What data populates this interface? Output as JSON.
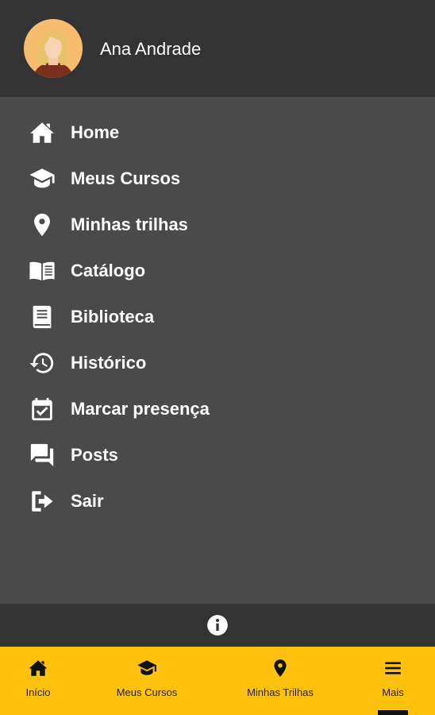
{
  "header": {
    "user_name": "Ana Andrade",
    "avatar_icon": "user-avatar"
  },
  "menu": {
    "items": [
      {
        "label": "Home",
        "icon": "home-icon"
      },
      {
        "label": "Meus Cursos",
        "icon": "graduation-cap-icon"
      },
      {
        "label": "Minhas trilhas",
        "icon": "map-pin-icon"
      },
      {
        "label": "Catálogo",
        "icon": "open-book-icon"
      },
      {
        "label": "Biblioteca",
        "icon": "book-icon"
      },
      {
        "label": "Histórico",
        "icon": "history-icon"
      },
      {
        "label": "Marcar presença",
        "icon": "calendar-check-icon"
      },
      {
        "label": "Posts",
        "icon": "chat-icon"
      },
      {
        "label": "Sair",
        "icon": "logout-icon"
      }
    ]
  },
  "info_bar": {
    "icon": "info-icon"
  },
  "bottom_nav": {
    "items": [
      {
        "label": "Início",
        "icon": "home-icon"
      },
      {
        "label": "Meus Cursos",
        "icon": "graduation-cap-icon"
      },
      {
        "label": "Minhas Trilhas",
        "icon": "map-pin-icon"
      },
      {
        "label": "Mais",
        "icon": "menu-icon"
      }
    ],
    "active_index": 3
  },
  "colors": {
    "header_bg": "#333333",
    "menu_bg": "#4a4a4a",
    "accent": "#fec10e",
    "text": "#ffffff"
  }
}
